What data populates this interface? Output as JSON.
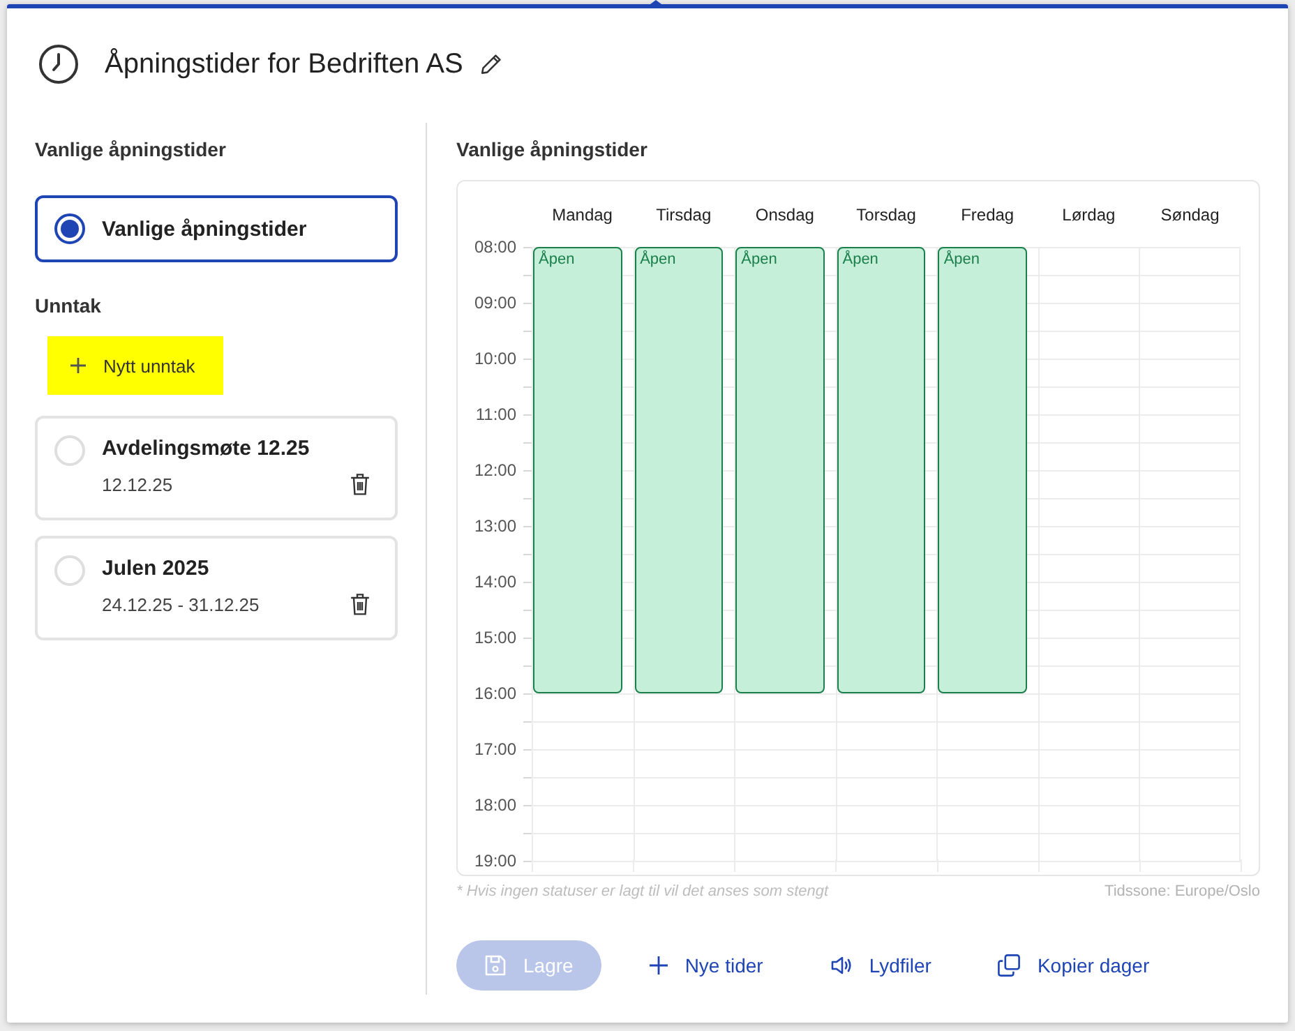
{
  "header": {
    "title": "Åpningstider for Bedriften AS"
  },
  "sidebar": {
    "regular": {
      "heading": "Vanlige åpningstider",
      "option": {
        "label": "Vanlige åpningstider",
        "selected": true
      }
    },
    "exceptions": {
      "heading": "Unntak",
      "add_button": {
        "label": "Nytt unntak",
        "highlighted": true
      },
      "items": [
        {
          "title": "Avdelingsmøte 12.25",
          "dates": "12.12.25",
          "selected": false
        },
        {
          "title": "Julen 2025",
          "dates": "24.12.25 - 31.12.25",
          "selected": false
        }
      ]
    }
  },
  "schedule": {
    "heading": "Vanlige åpningstider",
    "times": [
      "08:00",
      "09:00",
      "10:00",
      "11:00",
      "12:00",
      "13:00",
      "14:00",
      "15:00",
      "16:00",
      "17:00",
      "18:00",
      "19:00"
    ],
    "days": [
      {
        "label": "Mandag",
        "status": "Åpen",
        "level": 0.7273
      },
      {
        "label": "Tirsdag",
        "status": "Åpen",
        "level": 0.7273
      },
      {
        "label": "Onsdag",
        "status": "Åpen",
        "level": 0.7273
      },
      {
        "label": "Torsdag",
        "status": "Åpen",
        "level": 0.7273
      },
      {
        "label": "Fredag",
        "status": "Åpen",
        "level": 0.7273
      },
      {
        "label": "Lørdag"
      },
      {
        "label": "Søndag"
      }
    ],
    "note": "* Hvis ingen statuser er lagt til vil det anses som stengt",
    "timezone": "Tidssone: Europe/Oslo"
  },
  "actions": [
    {
      "label": "Lagre",
      "kind": "save",
      "disabled": true
    },
    {
      "label": "Nye tider",
      "kind": "add",
      "disabled": false
    },
    {
      "label": "Lydfiler",
      "kind": "audio",
      "disabled": false
    },
    {
      "label": "Kopier dager",
      "kind": "copy",
      "disabled": false
    }
  ]
}
